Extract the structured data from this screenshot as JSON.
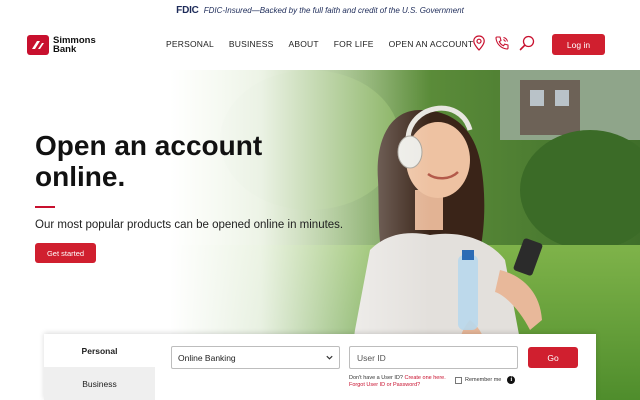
{
  "fdic": {
    "logo": "FDIC",
    "text": "FDIC-Insured—Backed by the full faith and credit of the U.S. Government"
  },
  "header": {
    "brand_line1": "Simmons",
    "brand_line2": "Bank",
    "nav": [
      {
        "label": "PERSONAL"
      },
      {
        "label": "BUSINESS"
      },
      {
        "label": "ABOUT"
      },
      {
        "label": "FOR LIFE"
      },
      {
        "label": "OPEN AN ACCOUNT"
      }
    ],
    "icons": [
      "location-pin-icon",
      "phone-icon",
      "search-icon"
    ],
    "login_label": "Log in"
  },
  "hero": {
    "title": "Open an account online.",
    "subtitle": "Our most popular products can be opened online in minutes.",
    "cta_label": "Get started"
  },
  "login_panel": {
    "tabs": [
      {
        "label": "Personal",
        "active": true
      },
      {
        "label": "Business",
        "active": false
      }
    ],
    "account_type_selected": "Online Banking",
    "user_id_placeholder": "User ID",
    "go_label": "Go",
    "no_user_id_text": "Don't have a User ID?",
    "enroll_link": "Create one here.",
    "forgot_link": "Forgot User ID or Password?",
    "remember_label": "Remember me",
    "info_glyph": "i"
  },
  "colors": {
    "brand_red": "#d01f2f",
    "fdic_navy": "#1d2b59"
  }
}
